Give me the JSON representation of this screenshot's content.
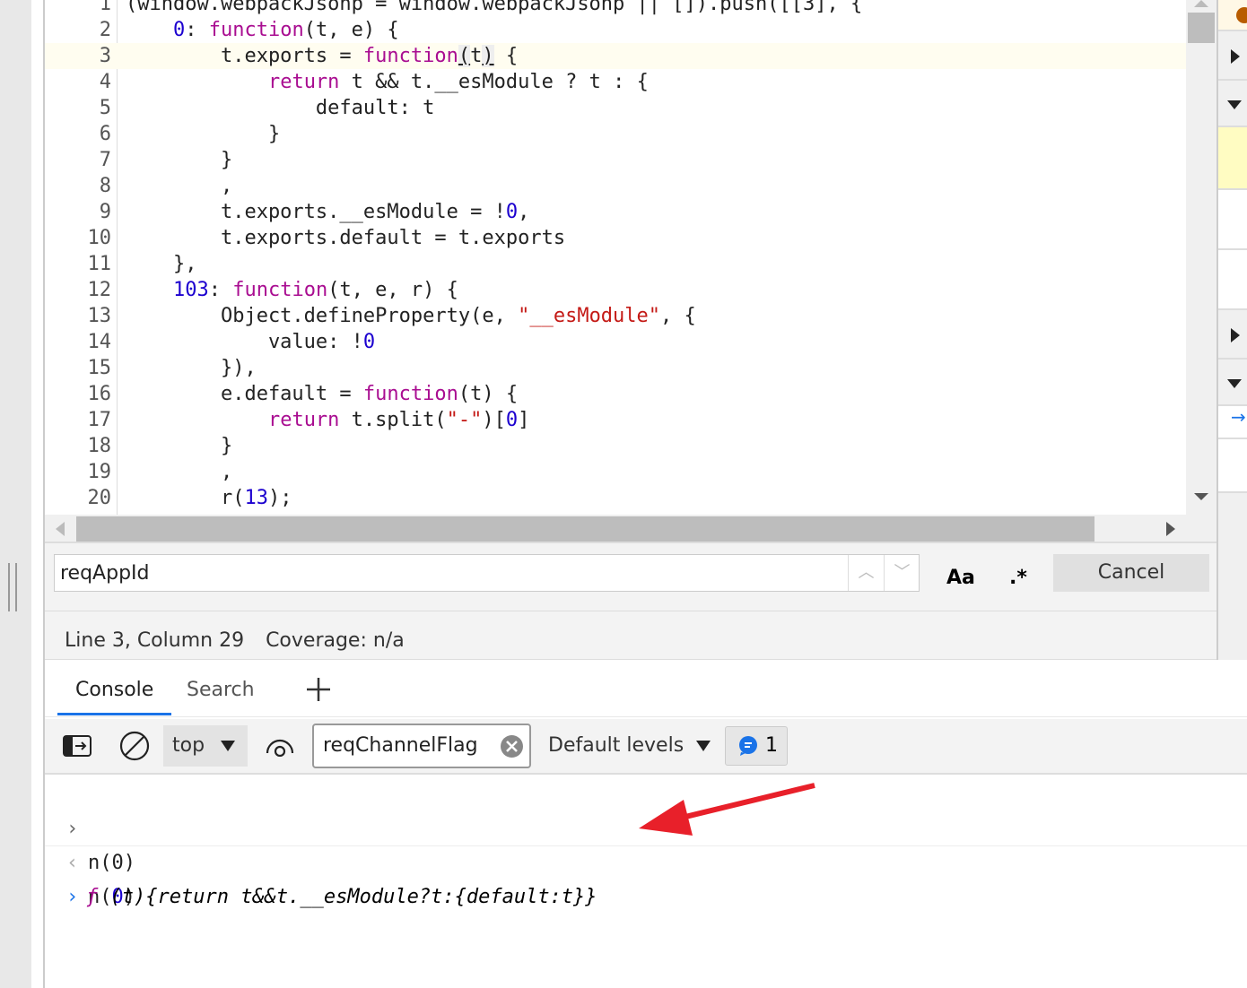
{
  "editor": {
    "lines": [
      {
        "n": "1",
        "seg": [
          [
            "",
            "(window.webpackJsonp = window.webpackJsonp || []).push([[3], {"
          ]
        ]
      },
      {
        "n": "2",
        "seg": [
          [
            "",
            "    "
          ],
          [
            "num",
            "0"
          ],
          [
            "",
            ": "
          ],
          [
            "kw",
            "function"
          ],
          [
            "",
            "(t, e) {"
          ]
        ]
      },
      {
        "n": "3",
        "seg": [
          [
            "",
            "        t.exports = "
          ],
          [
            "kw",
            "function"
          ],
          [
            "caret",
            ""
          ],
          [
            "br",
            "("
          ],
          [
            "",
            "t"
          ],
          [
            "br",
            ")"
          ],
          [
            "",
            " {"
          ]
        ]
      },
      {
        "n": "4",
        "seg": [
          [
            "",
            "            "
          ],
          [
            "kw",
            "return"
          ],
          [
            "",
            " t && t.__esModule ? t : {"
          ]
        ]
      },
      {
        "n": "5",
        "seg": [
          [
            "",
            "                default: t"
          ]
        ]
      },
      {
        "n": "6",
        "seg": [
          [
            "",
            "            }"
          ]
        ]
      },
      {
        "n": "7",
        "seg": [
          [
            "",
            "        }"
          ]
        ]
      },
      {
        "n": "8",
        "seg": [
          [
            "",
            "        ,"
          ]
        ]
      },
      {
        "n": "9",
        "seg": [
          [
            "",
            "        t.exports.__esModule = !"
          ],
          [
            "num",
            "0"
          ],
          [
            "",
            ","
          ]
        ]
      },
      {
        "n": "10",
        "seg": [
          [
            "",
            "        t.exports.default = t.exports"
          ]
        ]
      },
      {
        "n": "11",
        "seg": [
          [
            "",
            "    },"
          ]
        ]
      },
      {
        "n": "12",
        "seg": [
          [
            "",
            "    "
          ],
          [
            "num",
            "103"
          ],
          [
            "",
            ": "
          ],
          [
            "kw",
            "function"
          ],
          [
            "",
            "(t, e, r) {"
          ]
        ]
      },
      {
        "n": "13",
        "seg": [
          [
            "",
            "        Object.defineProperty(e, "
          ],
          [
            "str",
            "\"__esModule\""
          ],
          [
            "",
            ", {"
          ]
        ]
      },
      {
        "n": "14",
        "seg": [
          [
            "",
            "            value: !"
          ],
          [
            "num",
            "0"
          ]
        ]
      },
      {
        "n": "15",
        "seg": [
          [
            "",
            "        }),"
          ]
        ]
      },
      {
        "n": "16",
        "seg": [
          [
            "",
            "        e.default = "
          ],
          [
            "kw",
            "function"
          ],
          [
            "",
            "(t) {"
          ]
        ]
      },
      {
        "n": "17",
        "seg": [
          [
            "",
            "            "
          ],
          [
            "kw",
            "return"
          ],
          [
            "",
            " t.split("
          ],
          [
            "str",
            "\"-\""
          ],
          [
            "",
            ")["
          ],
          [
            "num",
            "0"
          ],
          [
            "",
            "]"
          ]
        ]
      },
      {
        "n": "18",
        "seg": [
          [
            "",
            "        }"
          ]
        ]
      },
      {
        "n": "19",
        "seg": [
          [
            "",
            "        ,"
          ]
        ]
      },
      {
        "n": "20",
        "seg": [
          [
            "",
            "        r("
          ],
          [
            "num",
            "13"
          ],
          [
            "",
            ");"
          ]
        ]
      }
    ],
    "current_line": 3
  },
  "search": {
    "value": "reqAppId",
    "match_case_label": "Aa",
    "regex_label": ".*",
    "cancel_label": "Cancel"
  },
  "status": {
    "position": "Line 3, Column 29",
    "coverage": "Coverage: n/a"
  },
  "tabs": [
    {
      "label": "Console",
      "active": true
    },
    {
      "label": "Search",
      "active": false
    }
  ],
  "toolbar": {
    "context": "top",
    "filter_value": "reqChannelFlag",
    "levels": "Default levels",
    "message_count": "1"
  },
  "console": {
    "input": "n(0)",
    "input_prefix": "n(",
    "input_num": "0",
    "input_suffix": ")",
    "result_f": "ƒ",
    "result": " (t){return t&&t.__esModule?t:{default:t}}"
  },
  "colors": {
    "accent": "#1a73e8",
    "annotation_arrow": "#e8202a",
    "keyword": "#a90d91",
    "number": "#1c00cf",
    "string": "#c41a16"
  }
}
